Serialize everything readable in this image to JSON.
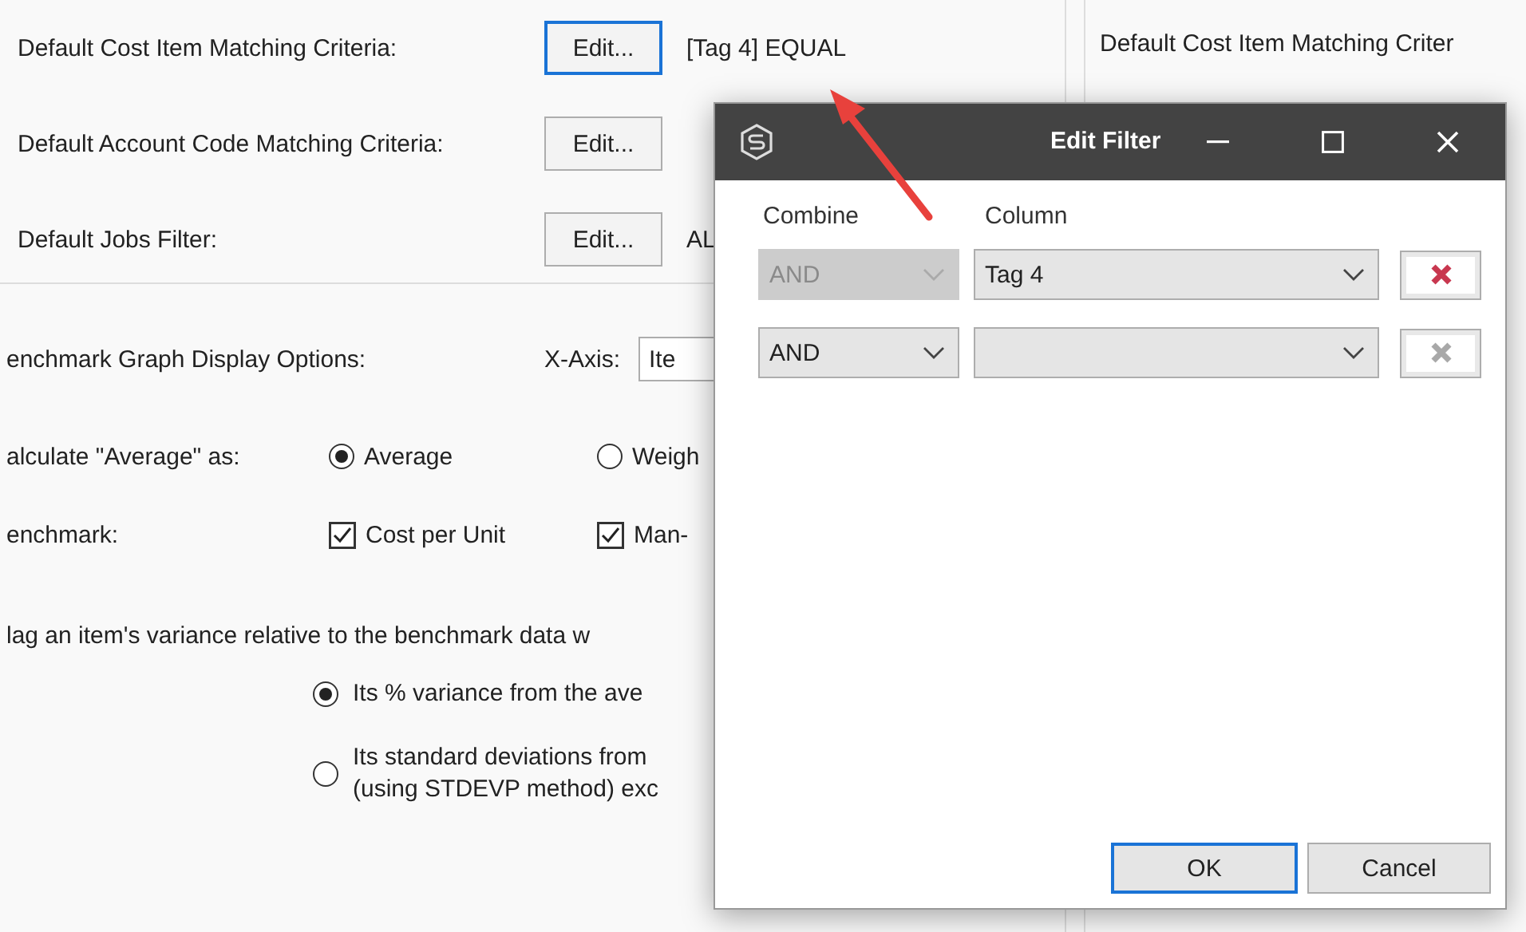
{
  "settings": {
    "rows": [
      {
        "label": "Default Cost Item Matching Criteria:",
        "button": "Edit...",
        "focused": true,
        "value": "[Tag 4] EQUAL"
      },
      {
        "label": "Default Account Code Matching Criteria:",
        "button": "Edit...",
        "focused": false
      },
      {
        "label": "Default Jobs Filter:",
        "button": "Edit...",
        "focused": false,
        "value": "AL"
      }
    ]
  },
  "graph_options": {
    "label": "enchmark Graph Display Options:",
    "x_axis_label": "X-Axis:",
    "x_axis_value": "Ite"
  },
  "average": {
    "label": "alculate \"Average\" as:",
    "options": [
      {
        "label": "Average",
        "selected": true
      },
      {
        "label": "Weigh",
        "selected": false
      }
    ]
  },
  "benchmark": {
    "label": "enchmark:",
    "options": [
      {
        "label": "Cost per Unit",
        "checked": true
      },
      {
        "label": "Man-",
        "checked": true
      }
    ]
  },
  "flag": {
    "text": "lag an item's variance relative to the benchmark data w",
    "options": [
      {
        "lines": [
          "Its % variance from the ave"
        ],
        "selected": true
      },
      {
        "lines": [
          "Its standard deviations from",
          "(using STDEVP method) exc"
        ],
        "selected": false
      }
    ]
  },
  "right_panel": {
    "label": "Default Cost Item Matching Criter"
  },
  "dialog": {
    "title": "Edit Filter",
    "columns": [
      "Combine",
      "Column"
    ],
    "rows": [
      {
        "combine": "AND",
        "combine_disabled": true,
        "column": "Tag 4",
        "delete_enabled": true
      },
      {
        "combine": "AND",
        "combine_disabled": false,
        "delete_enabled": false
      }
    ],
    "buttons": [
      {
        "label": "OK",
        "default": true
      },
      {
        "label": "Cancel",
        "default": false
      }
    ]
  }
}
